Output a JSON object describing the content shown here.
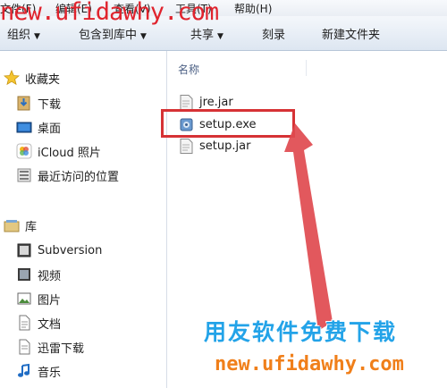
{
  "menu": {
    "file": "文件(F)",
    "edit": "编辑(E)",
    "view": "查看(V)",
    "tools": "工具(T)",
    "help": "帮助(H)"
  },
  "toolbar": {
    "organize": "组织",
    "include_in_library": "包含到库中",
    "share": "共享",
    "burn": "刻录",
    "new_folder": "新建文件夹"
  },
  "sidebar": {
    "favorites": {
      "label": "收藏夹",
      "items": [
        "下载",
        "桌面",
        "iCloud 照片",
        "最近访问的位置"
      ]
    },
    "libraries": {
      "label": "库",
      "items": [
        "Subversion",
        "视频",
        "图片",
        "文档",
        "迅雷下载",
        "音乐"
      ]
    }
  },
  "main": {
    "column_name": "名称",
    "files": [
      "jre.jar",
      "setup.exe",
      "setup.jar"
    ]
  },
  "watermark": {
    "top_url": "new.ufidawhy.com",
    "cn_text": "用友软件免费下载",
    "bottom_url": "new.ufidawhy.com"
  },
  "colors": {
    "highlight_box": "#d63235",
    "arrow": "#e04a4f",
    "watermark_blue": "#23a3e8",
    "watermark_orange": "#f07f1a"
  }
}
